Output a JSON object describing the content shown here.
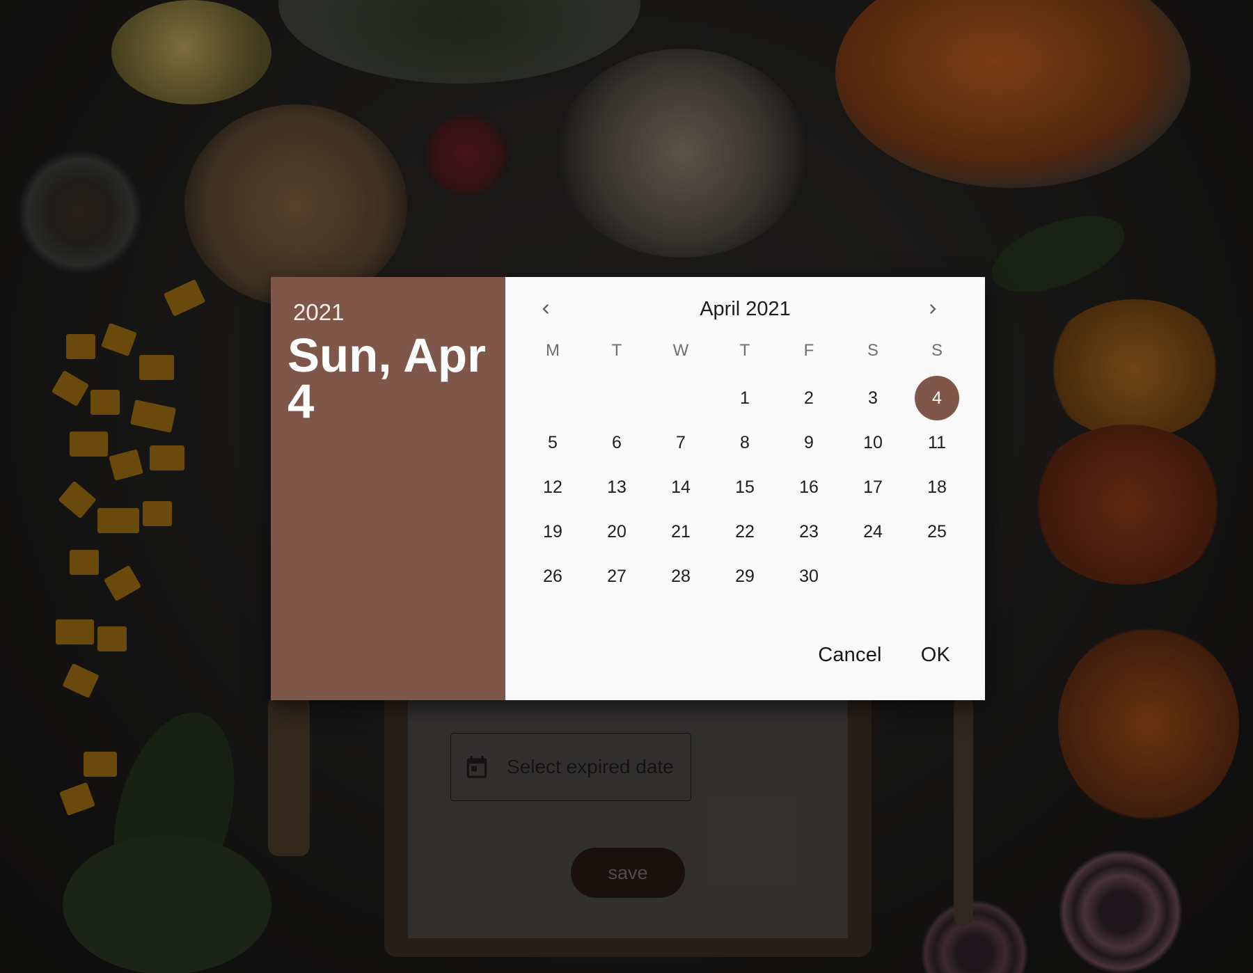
{
  "background": {
    "form": {
      "date_field_placeholder": "Select expired date",
      "save_label": "save"
    }
  },
  "date_picker": {
    "header": {
      "year": "2021",
      "selected_date": "Sun, Apr 4"
    },
    "month_label": "April 2021",
    "prev_icon": "chevron-left-icon",
    "next_icon": "chevron-right-icon",
    "weekdays": [
      "M",
      "T",
      "W",
      "T",
      "F",
      "S",
      "S"
    ],
    "weeks": [
      [
        "",
        "",
        "",
        "1",
        "2",
        "3",
        "4"
      ],
      [
        "5",
        "6",
        "7",
        "8",
        "9",
        "10",
        "11"
      ],
      [
        "12",
        "13",
        "14",
        "15",
        "16",
        "17",
        "18"
      ],
      [
        "19",
        "20",
        "21",
        "22",
        "23",
        "24",
        "25"
      ],
      [
        "26",
        "27",
        "28",
        "29",
        "30",
        "",
        ""
      ]
    ],
    "selected_day": "4",
    "actions": {
      "cancel_label": "Cancel",
      "ok_label": "OK"
    },
    "accent_color": "#7f574a"
  }
}
